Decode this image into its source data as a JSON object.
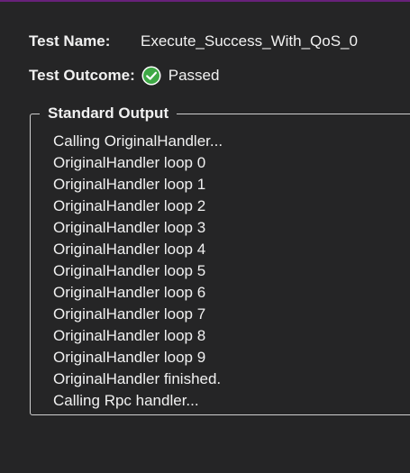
{
  "test": {
    "name_label": "Test Name:",
    "name_value": "Execute_Success_With_QoS_0",
    "outcome_label": "Test Outcome:",
    "outcome_value": "Passed",
    "outcome_icon": "check-circle-icon",
    "outcome_color": "#3ea845"
  },
  "output": {
    "title": "Standard Output",
    "lines": [
      "Calling OriginalHandler...",
      "OriginalHandler loop 0",
      "OriginalHandler loop 1",
      "OriginalHandler loop 2",
      "OriginalHandler loop 3",
      "OriginalHandler loop 4",
      "OriginalHandler loop 5",
      "OriginalHandler loop 6",
      "OriginalHandler loop 7",
      "OriginalHandler loop 8",
      "OriginalHandler loop 9",
      "OriginalHandler finished.",
      "Calling Rpc handler..."
    ]
  },
  "colors": {
    "background": "#252526",
    "accent_border": "#68217a",
    "text": "#f1f1f1"
  }
}
